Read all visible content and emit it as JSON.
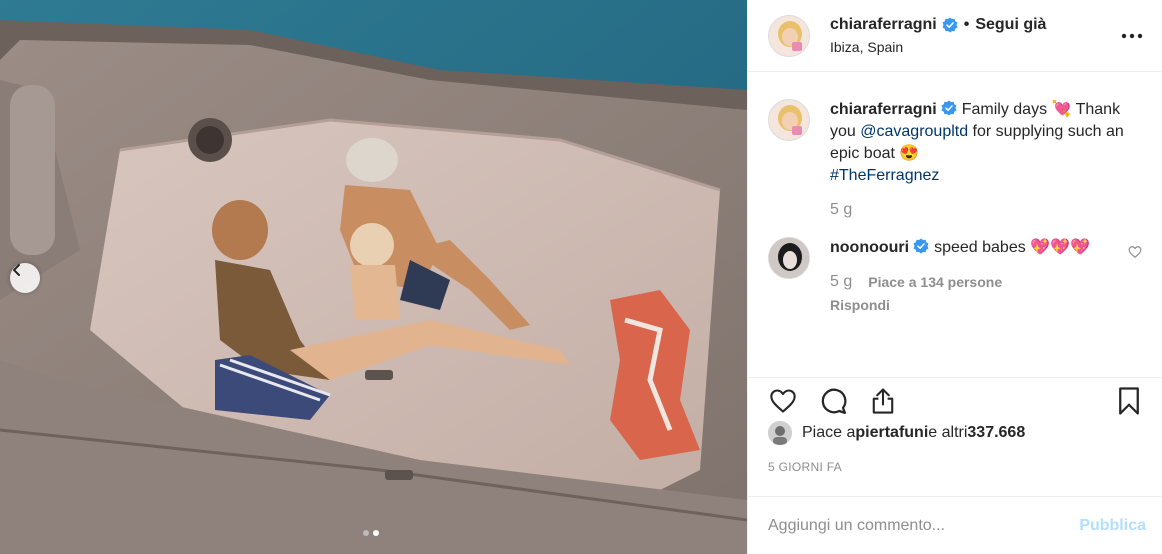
{
  "photo": {
    "alt": "",
    "dots_total": 2,
    "dots_active": 1
  },
  "post": {
    "author": {
      "username": "chiaraferragni",
      "verified": true,
      "separator": "•",
      "follow_status": "Segui già",
      "location": "Ibiza, Spain"
    },
    "more_label": "•••",
    "caption": {
      "username": "chiaraferragni",
      "text_before": "Family days 💘 Thank you ",
      "mention": "@cavagroupltd",
      "text_after": " for supplying such an epic boat 😍",
      "hashtag": "#TheFerragnez",
      "time": "5 g"
    },
    "comments": [
      {
        "username": "noonoouri",
        "verified": true,
        "text": "speed babes 💖💖💖",
        "time": "5 g",
        "likes": "Piace a 134 persone",
        "reply_label": "Rispondi"
      }
    ],
    "likes_prefix": "Piace a ",
    "likes_user": "piertafuni",
    "likes_middle": " e altri ",
    "likes_count": "337.668",
    "timeago": "5 GIORNI FA",
    "add_comment": {
      "placeholder": "Aggiungi un commento...",
      "publish_label": "Pubblica",
      "publish_color": "#b2dffc"
    }
  },
  "colors": {
    "verified": "#3897f0",
    "text": "#262626",
    "muted": "#8e8e8e",
    "link": "#00376b"
  }
}
